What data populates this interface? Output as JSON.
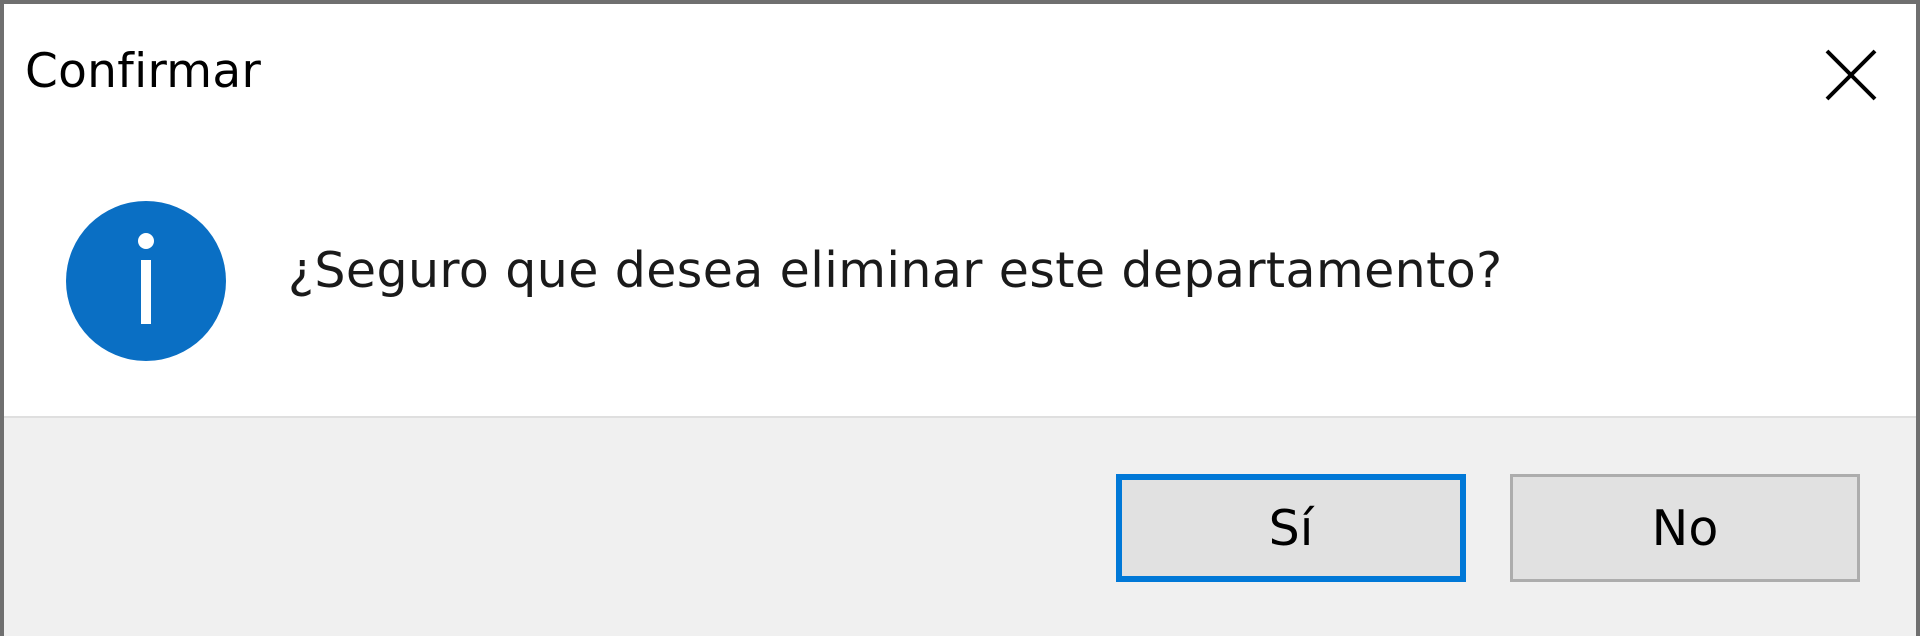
{
  "dialog": {
    "title": "Confirmar",
    "message": "¿Seguro que desea eliminar este departamento?",
    "icon": "info-icon",
    "buttons": {
      "yes_label": "Sí",
      "no_label": "No"
    },
    "default_button": "Sí"
  },
  "colors": {
    "accent": "#0078d7",
    "icon_fill": "#0a6fc4",
    "footer_bg": "#f0f0f0",
    "button_bg": "#e1e1e1"
  }
}
